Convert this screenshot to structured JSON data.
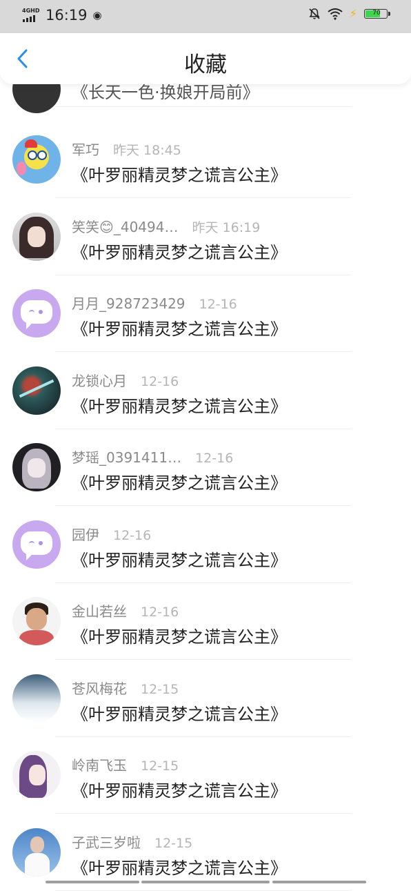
{
  "status_bar": {
    "network": "4GHD",
    "time": "16:19",
    "battery": "70",
    "battery_level": 0.7
  },
  "header": {
    "title": "收藏"
  },
  "partial_item": {
    "book": "《长天一色·换娘开局前》"
  },
  "items": [
    {
      "name": "军巧",
      "date": "昨天 18:45",
      "book": "《叶罗丽精灵梦之谎言公主》",
      "avatar": "spongebob"
    },
    {
      "name": "笑笑😊_40494…",
      "date": "昨天 16:19",
      "book": "《叶罗丽精灵梦之谎言公主》",
      "avatar": "anime-girl"
    },
    {
      "name": "月月_928723429",
      "date": "12-16",
      "book": "《叶罗丽精灵梦之谎言公主》",
      "avatar": "default-purple"
    },
    {
      "name": "龙锁心月",
      "date": "12-16",
      "book": "《叶罗丽精灵梦之谎言公主》",
      "avatar": "game-art"
    },
    {
      "name": "梦瑶_0391411…",
      "date": "12-16",
      "book": "《叶罗丽精灵梦之谎言公主》",
      "avatar": "anime-girl-dark"
    },
    {
      "name": "园伊",
      "date": "12-16",
      "book": "《叶罗丽精灵梦之谎言公主》",
      "avatar": "default-purple"
    },
    {
      "name": "金山若丝",
      "date": "12-16",
      "book": "《叶罗丽精灵梦之谎言公主》",
      "avatar": "boy-photo"
    },
    {
      "name": "苍风梅花",
      "date": "12-15",
      "book": "《叶罗丽精灵梦之谎言公主》",
      "avatar": "sky-photo"
    },
    {
      "name": "岭南飞玉",
      "date": "12-15",
      "book": "《叶罗丽精灵梦之谎言公主》",
      "avatar": "anime-girl-purple"
    },
    {
      "name": "子武三岁啦",
      "date": "12-15",
      "book": "《叶罗丽精灵梦之谎言公主》",
      "avatar": "woman-photo"
    }
  ]
}
